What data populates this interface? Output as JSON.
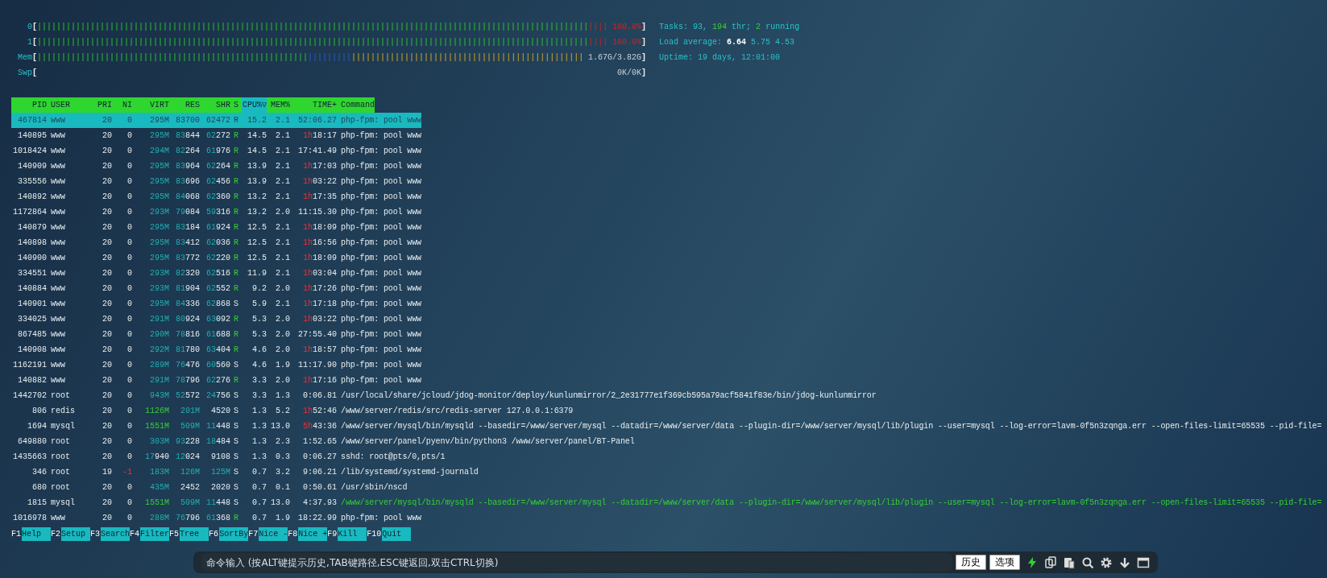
{
  "meters": [
    {
      "label": "0",
      "open": "[",
      "close": "]",
      "segments": [
        {
          "kind": "normal",
          "text": "||||||||||||||||||||||||||||||||||||||||||||||||||||||||||||||||||||||||||||||||||||||||||||||||||||||||||||||||||"
        },
        {
          "kind": "kernel",
          "text": "||||"
        }
      ],
      "reading": "100.0%"
    },
    {
      "label": "1",
      "open": "[",
      "close": "]",
      "segments": [
        {
          "kind": "normal",
          "text": "||||||||||||||||||||||||||||||||||||||||||||||||||||||||||||||||||||||||||||||||||||||||||||||||||||||||||||||||||"
        },
        {
          "kind": "kernel",
          "text": "||||"
        }
      ],
      "reading": "100.0%"
    },
    {
      "label": "Mem",
      "open": "[",
      "close": "]",
      "segments": [
        {
          "kind": "used",
          "text": "||||||||||||||||||||||||||||||||||||||||||||||||||||||||"
        },
        {
          "kind": "buffers",
          "text": "|||||||||"
        },
        {
          "kind": "cache",
          "text": "||||||||||||||||||||||||||||||||||||||||||||||||"
        }
      ],
      "reading": "1.67G/3.82G"
    },
    {
      "label": "Swp",
      "open": "[",
      "close": "]",
      "reading": "0K/0K"
    }
  ],
  "info": [
    [
      {
        "text": "Tasks: ",
        "kind": "label"
      },
      {
        "text": "93",
        "kind": "label"
      },
      {
        "text": ", ",
        "kind": "label"
      },
      {
        "text": "194",
        "kind": "value"
      },
      {
        "text": " thr; ",
        "kind": "label"
      },
      {
        "text": "2",
        "kind": "value"
      },
      {
        "text": " running",
        "kind": "label"
      }
    ],
    [
      {
        "text": "Load average: ",
        "kind": "label"
      },
      {
        "text": "6.64 ",
        "kind": "highlight"
      },
      {
        "text": "5.75 ",
        "kind": "label"
      },
      {
        "text": "4.53",
        "kind": "label"
      }
    ],
    [
      {
        "text": "Uptime: ",
        "kind": "label"
      },
      {
        "text": "19 days, 12:01:00",
        "kind": "label"
      }
    ]
  ],
  "table": {
    "columns": [
      {
        "label": "PID",
        "sorted": false
      },
      {
        "label": "USER",
        "sorted": false
      },
      {
        "label": "PRI",
        "sorted": false
      },
      {
        "label": "NI",
        "sorted": false
      },
      {
        "label": "VIRT",
        "sorted": false
      },
      {
        "label": "RES",
        "sorted": false
      },
      {
        "label": "SHR",
        "sorted": false
      },
      {
        "label": "S",
        "sorted": false
      },
      {
        "label": "CPU%▽",
        "sorted": true
      },
      {
        "label": "MEM%",
        "sorted": false
      },
      {
        "label": "TIME+",
        "sorted": false
      },
      {
        "label": "Command",
        "sorted": false
      }
    ],
    "rows": [
      {
        "selected": true,
        "running": true,
        "thread": false,
        "cells": [
          "467814",
          "www",
          "20",
          "0",
          "295M",
          "83700",
          "62472",
          "R",
          "15.2",
          "2.1",
          "52:06.27",
          "php-fpm: pool www"
        ]
      },
      {
        "selected": false,
        "running": true,
        "thread": false,
        "cells": [
          "140895",
          "www",
          "20",
          "0",
          "295M",
          "83844",
          "62272",
          "R",
          "14.5",
          "2.1",
          "1h18:17",
          "php-fpm: pool www"
        ]
      },
      {
        "selected": false,
        "running": true,
        "thread": false,
        "cells": [
          "1018424",
          "www",
          "20",
          "0",
          "294M",
          "82264",
          "61976",
          "R",
          "14.5",
          "2.1",
          "17:41.49",
          "php-fpm: pool www"
        ]
      },
      {
        "selected": false,
        "running": true,
        "thread": false,
        "cells": [
          "140909",
          "www",
          "20",
          "0",
          "295M",
          "83964",
          "62264",
          "R",
          "13.9",
          "2.1",
          "1h17:03",
          "php-fpm: pool www"
        ]
      },
      {
        "selected": false,
        "running": true,
        "thread": false,
        "cells": [
          "335556",
          "www",
          "20",
          "0",
          "295M",
          "83696",
          "62456",
          "R",
          "13.9",
          "2.1",
          "1h03:22",
          "php-fpm: pool www"
        ]
      },
      {
        "selected": false,
        "running": true,
        "thread": false,
        "cells": [
          "140892",
          "www",
          "20",
          "0",
          "295M",
          "84068",
          "62360",
          "R",
          "13.2",
          "2.1",
          "1h17:35",
          "php-fpm: pool www"
        ]
      },
      {
        "selected": false,
        "running": true,
        "thread": false,
        "cells": [
          "1172864",
          "www",
          "20",
          "0",
          "293M",
          "79084",
          "59316",
          "R",
          "13.2",
          "2.0",
          "11:15.30",
          "php-fpm: pool www"
        ]
      },
      {
        "selected": false,
        "running": true,
        "thread": false,
        "cells": [
          "140879",
          "www",
          "20",
          "0",
          "295M",
          "83184",
          "61924",
          "R",
          "12.5",
          "2.1",
          "1h18:09",
          "php-fpm: pool www"
        ]
      },
      {
        "selected": false,
        "running": true,
        "thread": false,
        "cells": [
          "140898",
          "www",
          "20",
          "0",
          "295M",
          "83412",
          "62036",
          "R",
          "12.5",
          "2.1",
          "1h16:56",
          "php-fpm: pool www"
        ]
      },
      {
        "selected": false,
        "running": true,
        "thread": false,
        "cells": [
          "140900",
          "www",
          "20",
          "0",
          "295M",
          "83772",
          "62220",
          "R",
          "12.5",
          "2.1",
          "1h18:09",
          "php-fpm: pool www"
        ]
      },
      {
        "selected": false,
        "running": true,
        "thread": false,
        "cells": [
          "334551",
          "www",
          "20",
          "0",
          "293M",
          "82320",
          "62516",
          "R",
          "11.9",
          "2.1",
          "1h03:04",
          "php-fpm: pool www"
        ]
      },
      {
        "selected": false,
        "running": true,
        "thread": false,
        "cells": [
          "140884",
          "www",
          "20",
          "0",
          "293M",
          "81904",
          "62552",
          "R",
          "9.2",
          "2.0",
          "1h17:26",
          "php-fpm: pool www"
        ]
      },
      {
        "selected": false,
        "running": false,
        "thread": false,
        "cells": [
          "140901",
          "www",
          "20",
          "0",
          "295M",
          "84336",
          "62868",
          "S",
          "5.9",
          "2.1",
          "1h17:18",
          "php-fpm: pool www"
        ]
      },
      {
        "selected": false,
        "running": true,
        "thread": false,
        "cells": [
          "334025",
          "www",
          "20",
          "0",
          "291M",
          "80924",
          "63092",
          "R",
          "5.3",
          "2.0",
          "1h03:22",
          "php-fpm: pool www"
        ]
      },
      {
        "selected": false,
        "running": true,
        "thread": false,
        "cells": [
          "867485",
          "www",
          "20",
          "0",
          "290M",
          "78816",
          "61688",
          "R",
          "5.3",
          "2.0",
          "27:55.40",
          "php-fpm: pool www"
        ]
      },
      {
        "selected": false,
        "running": true,
        "thread": false,
        "cells": [
          "140908",
          "www",
          "20",
          "0",
          "292M",
          "81780",
          "63404",
          "R",
          "4.6",
          "2.0",
          "1h18:57",
          "php-fpm: pool www"
        ]
      },
      {
        "selected": false,
        "running": false,
        "thread": false,
        "cells": [
          "1162191",
          "www",
          "20",
          "0",
          "289M",
          "76476",
          "60560",
          "S",
          "4.6",
          "1.9",
          "11:17.90",
          "php-fpm: pool www"
        ]
      },
      {
        "selected": false,
        "running": true,
        "thread": false,
        "cells": [
          "140882",
          "www",
          "20",
          "0",
          "291M",
          "78796",
          "62276",
          "R",
          "3.3",
          "2.0",
          "1h17:16",
          "php-fpm: pool www"
        ]
      },
      {
        "selected": false,
        "running": false,
        "thread": false,
        "cells": [
          "1442702",
          "root",
          "20",
          "0",
          "943M",
          "52572",
          "24756",
          "S",
          "3.3",
          "1.3",
          "0:06.81",
          "/usr/local/share/jcloud/jdog-monitor/deploy/kunlunmirror/2_2e31777e1f369cb595a79acf5841f83e/bin/jdog-kunlunmirror"
        ]
      },
      {
        "selected": false,
        "running": false,
        "thread": false,
        "cells": [
          "806",
          "redis",
          "20",
          "0",
          "1126M",
          "201M",
          "4520",
          "S",
          "1.3",
          "5.2",
          "1h52:46",
          "/www/server/redis/src/redis-server 127.0.0.1:6379"
        ]
      },
      {
        "selected": false,
        "running": false,
        "thread": false,
        "cells": [
          "1694",
          "mysql",
          "20",
          "0",
          "1551M",
          "509M",
          "11448",
          "S",
          "1.3",
          "13.0",
          "5h43:36",
          "/www/server/mysql/bin/mysqld --basedir=/www/server/mysql --datadir=/www/server/data --plugin-dir=/www/server/mysql/lib/plugin --user=mysql --log-error=lavm-0f5n3zqnga.err --open-files-limit=65535 --pid-file="
        ]
      },
      {
        "selected": false,
        "running": false,
        "thread": false,
        "cells": [
          "649880",
          "root",
          "20",
          "0",
          "303M",
          "93228",
          "18484",
          "S",
          "1.3",
          "2.3",
          "1:52.65",
          "/www/server/panel/pyenv/bin/python3 /www/server/panel/BT-Panel"
        ]
      },
      {
        "selected": false,
        "running": false,
        "thread": false,
        "cells": [
          "1435663",
          "root",
          "20",
          "0",
          "17940",
          "12024",
          "9108",
          "S",
          "1.3",
          "0.3",
          "0:06.27",
          "sshd: root@pts/0,pts/1"
        ]
      },
      {
        "selected": false,
        "running": false,
        "thread": false,
        "cells": [
          "346",
          "root",
          "19",
          "-1",
          "183M",
          "126M",
          "125M",
          "S",
          "0.7",
          "3.2",
          "9:06.21",
          "/lib/systemd/systemd-journald"
        ]
      },
      {
        "selected": false,
        "running": false,
        "thread": false,
        "cells": [
          "680",
          "root",
          "20",
          "0",
          "435M",
          "2452",
          "2020",
          "S",
          "0.7",
          "0.1",
          "0:50.61",
          "/usr/sbin/nscd"
        ]
      },
      {
        "selected": false,
        "running": false,
        "thread": true,
        "cells": [
          "1815",
          "mysql",
          "20",
          "0",
          "1551M",
          "509M",
          "11448",
          "S",
          "0.7",
          "13.0",
          "4:37.93",
          "/www/server/mysql/bin/mysqld --basedir=/www/server/mysql --datadir=/www/server/data --plugin-dir=/www/server/mysql/lib/plugin --user=mysql --log-error=lavm-0f5n3zqnga.err --open-files-limit=65535 --pid-file="
        ]
      },
      {
        "selected": false,
        "running": true,
        "thread": false,
        "cells": [
          "1016978",
          "www",
          "20",
          "0",
          "288M",
          "76796",
          "61368",
          "R",
          "0.7",
          "1.9",
          "18:22.99",
          "php-fpm: pool www"
        ]
      }
    ]
  },
  "function_keys": [
    {
      "key": "F1",
      "label": "Help"
    },
    {
      "key": "F2",
      "label": "Setup"
    },
    {
      "key": "F3",
      "label": "Search"
    },
    {
      "key": "F4",
      "label": "Filter"
    },
    {
      "key": "F5",
      "label": "Tree"
    },
    {
      "key": "F6",
      "label": "SortBy"
    },
    {
      "key": "F7",
      "label": "Nice -"
    },
    {
      "key": "F8",
      "label": "Nice +"
    },
    {
      "key": "F9",
      "label": "Kill"
    },
    {
      "key": "F10",
      "label": "Quit"
    }
  ],
  "command_bar": {
    "placeholder": "命令输入 (按ALT键提示历史,TAB键路径,ESC键返回,双击CTRL切换)",
    "buttons": [
      "历史",
      "选项"
    ]
  }
}
